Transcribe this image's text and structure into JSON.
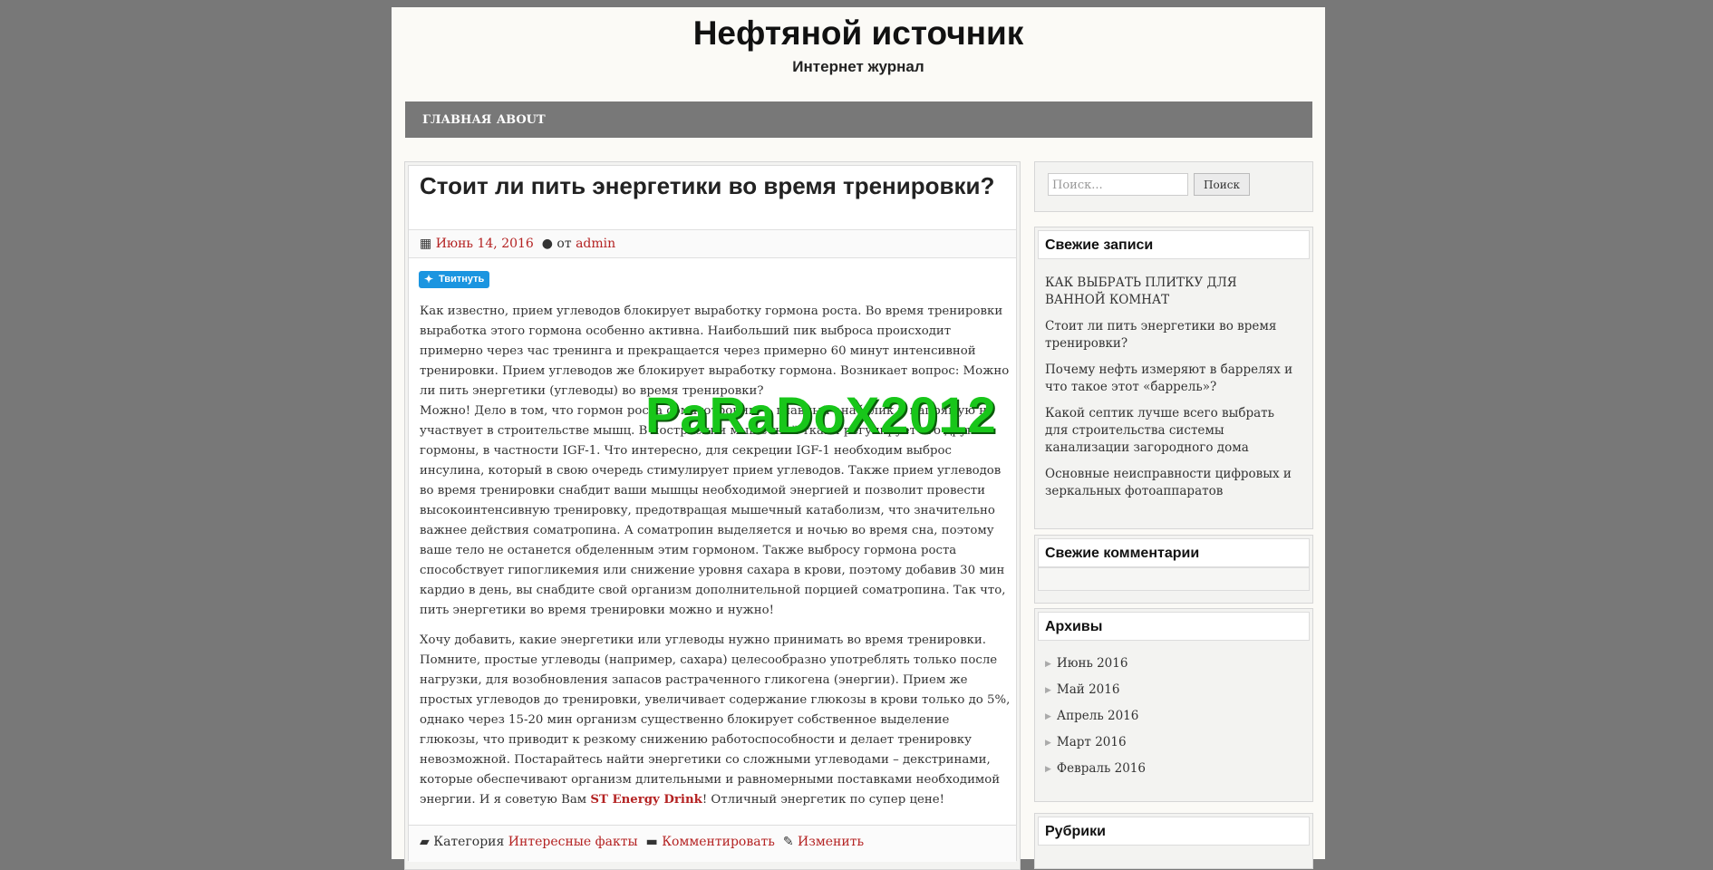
{
  "site": {
    "title": "Нефтяной источник",
    "description": "Интернет журнал"
  },
  "nav": {
    "items": [
      "ГЛАВНАЯ",
      "ABOUT"
    ]
  },
  "post": {
    "title": "Стоит ли пить энергетики во время тренировки?",
    "date": "Июнь 14, 2016",
    "by": "от",
    "author": "admin",
    "tweet_label": "Твитнуть",
    "paragraph1": "Как известно, прием углеводов блокирует выработку гормона роста. Во время тренировки выработка этого гормона особенно активна. Наибольший пик выброса происходит примерно через час тренинга и прекращается через примерно 60 минут интенсивной тренировки. Прием углеводов же блокирует выработку гормона. Возникает вопрос: Можно ли пить энергетики (углеводы) во время тренировки?",
    "paragraph2": "Можно! Дело в том, что гормон роста соматотропин — главный анаболик и напрямую не участвует в строительстве мышц. В построении мышечной ткани регулирует его другие гормоны, в частности IGF-1. Что интересно, для секреции IGF-1 необходим выброс инсулина, который в свою очередь стимулирует прием углеводов. Также прием углеводов во время тренировки снабдит ваши мышцы необходимой энергией и позволит провести высокоинтенсивную тренировку, предотвращая мышечный катаболизм, что значительно важнее действия соматропина. А соматропин выделяется и ночью во время сна, поэтому ваше тело не останется обделенным этим гормоном. Также выбросу гормона роста способствует гипогликемия или снижение уровня сахара в крови, поэтому добавив 30 мин кардио в день, вы снабдите свой организм дополнительной порцией соматропина. Так что, пить энергетики во время тренировки можно и нужно!",
    "paragraph3": "Хочу добавить, какие энергетики или углеводы нужно принимать во время тренировки. Помните, простые углеводы (например, сахара) целесообразно употреблять только после нагрузки, для возобновления запасов растраченного гликогена (энергии). Прием же простых углеводов до тренировки, увеличивает содержание глюкозы в крови только до 5%, однако через 15-20 мин организм существенно блокирует собственное выделение глюкозы, что приводит к резкому снижению работоспособности и делает тренировку невозможной. Постарайтесь найти энергетики со сложными углеводами – декстринами, которые обеспечивают организм длительными и равномерными поставками необходимой энергии. И я советую Вам",
    "link_text": "ST Energy Drink",
    "paragraph3_end": "! Отличный энергетик по супер цене!",
    "footer": {
      "category_label": "Категория",
      "category": "Интересные факты",
      "comment": "Комментировать",
      "edit": "Изменить"
    }
  },
  "sidebar": {
    "search_placeholder": "Поиск...",
    "search_button": "Поиск",
    "recent_posts_title": "Свежие записи",
    "recent_posts": [
      "КАК ВЫБРАТЬ ПЛИТКУ ДЛЯ ВАННОЙ КОМНАТ",
      "Стоит ли пить энергетики во время тренировки?",
      "Почему нефть измеряют в баррелях и что такое этот «баррель»?",
      "Какой септик лучше всего выбрать для строительства системы канализации загородного дома",
      "Основные неисправности цифровых и зеркальных фотоаппаратов"
    ],
    "recent_comments_title": "Свежие комментарии",
    "archives_title": "Архивы",
    "archives": [
      "Июнь 2016",
      "Май 2016",
      "Апрель 2016",
      "Март 2016",
      "Февраль 2016"
    ],
    "categories_title": "Рубрики"
  },
  "watermark": "PaRaDoX2012"
}
